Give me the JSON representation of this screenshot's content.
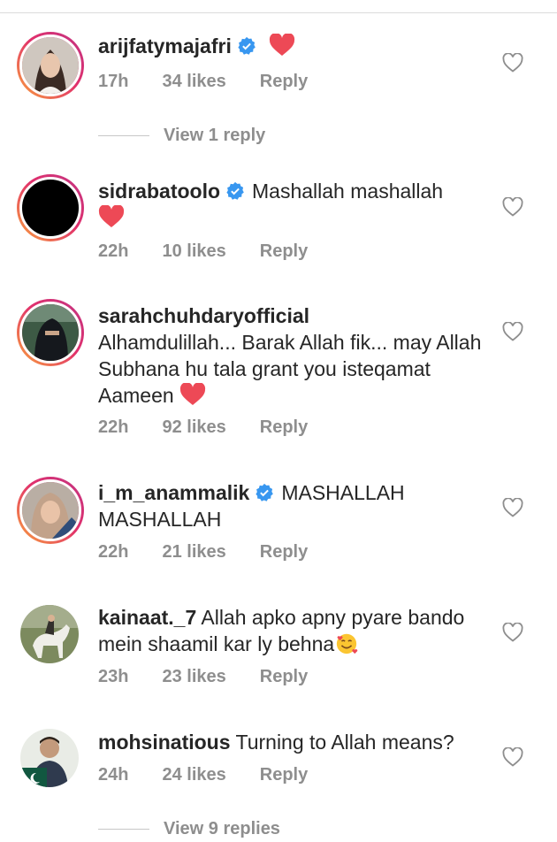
{
  "comments": [
    {
      "username": "arijfatymajafri",
      "verified": true,
      "text": "",
      "heart": true,
      "time": "17h",
      "likes": "34 likes",
      "reply": "Reply",
      "avatar_icon": "woman-portrait-avatar",
      "view_replies": "View 1 reply"
    },
    {
      "username": "sidrabatoolo",
      "verified": true,
      "text": "Mashallah mashallah",
      "heart": true,
      "time": "22h",
      "likes": "10 likes",
      "reply": "Reply",
      "avatar_icon": "black-avatar"
    },
    {
      "username": "sarahchuhdaryofficial",
      "verified": false,
      "text": "Alhamdulillah... Barak Allah fik... may Allah Subhana hu tala grant you isteqamat Aameen",
      "heart": true,
      "time": "22h",
      "likes": "92 likes",
      "reply": "Reply",
      "avatar_icon": "niqab-portrait-avatar"
    },
    {
      "username": "i_m_anammalik",
      "verified": true,
      "text": "MASHALLAH MASHALLAH",
      "heart": false,
      "time": "22h",
      "likes": "21 likes",
      "reply": "Reply",
      "avatar_icon": "hijab-portrait-avatar"
    },
    {
      "username": "kainaat._7",
      "verified": false,
      "text": "Allah apko apny pyare bando mein shaamil kar ly behna",
      "emoji": "smiling-face-with-hearts",
      "heart": false,
      "time": "23h",
      "likes": "23 likes",
      "reply": "Reply",
      "avatar_icon": "horse-rider-avatar"
    },
    {
      "username": "mohsinatious",
      "verified": false,
      "text": "Turning to Allah means?",
      "heart": false,
      "time": "24h",
      "likes": "24 likes",
      "reply": "Reply",
      "avatar_icon": "man-pakistan-flag-avatar",
      "view_replies": "View 9 replies"
    }
  ],
  "colors": {
    "verified": "#3897f0",
    "heart": "#ed4956",
    "meta": "#8e8e8e",
    "text": "#262626"
  }
}
